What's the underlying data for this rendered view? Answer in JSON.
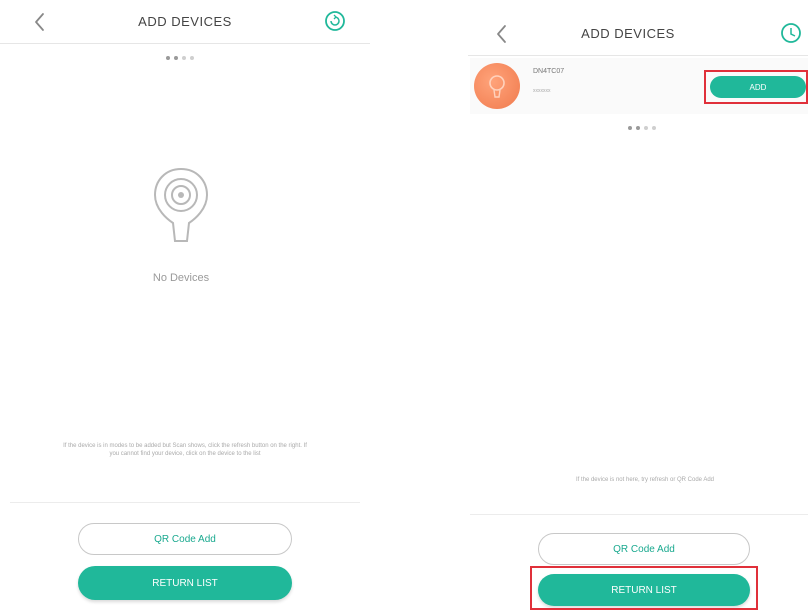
{
  "left": {
    "header": {
      "title": "ADD DEVICES"
    },
    "empty_state": {
      "text": "No Devices"
    },
    "hint": "If the device is in modes to be added but Scan shows, click the refresh button on the right. If you cannot find your device, click on the device to the list",
    "buttons": {
      "qr_label": "QR Code Add",
      "return_label": "RETURN LIST"
    }
  },
  "right": {
    "header": {
      "title": "ADD DEVICES"
    },
    "device": {
      "name": "DN4TC07",
      "sub": "xxxxxxx",
      "add_label": "ADD"
    },
    "hint": "If the device is not here, try refresh or QR Code Add",
    "buttons": {
      "qr_label": "QR Code Add",
      "return_label": "RETURN LIST"
    }
  },
  "colors": {
    "accent": "#20b89a",
    "highlight": "#e0303a",
    "avatar": "#f07a4d"
  },
  "icons": {
    "back": "chevron-left-icon",
    "refresh": "refresh-icon",
    "empty": "camera-pin-icon"
  }
}
